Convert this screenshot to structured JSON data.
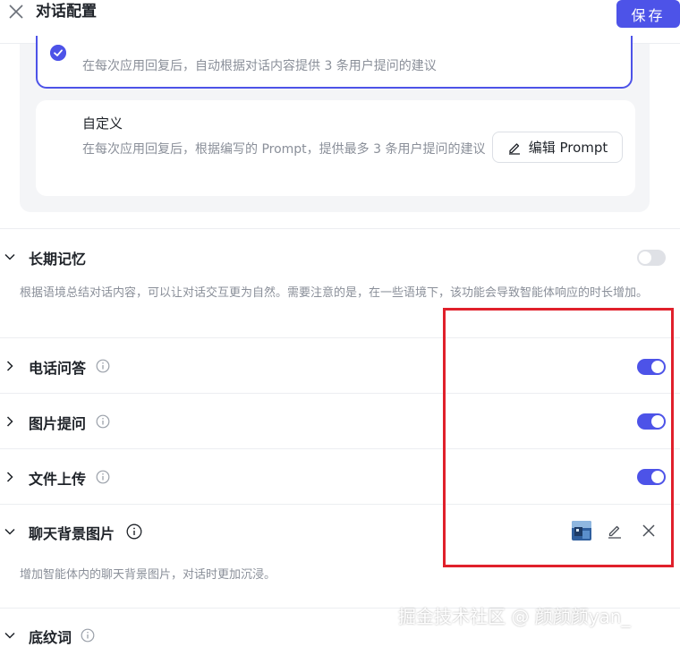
{
  "header": {
    "title": "对话配置",
    "save_label": "保存"
  },
  "suggestion": {
    "default_option_desc": "在每次应用回复后，自动根据对话内容提供 3 条用户提问的建议",
    "custom_option_title": "自定义",
    "custom_option_desc": "在每次应用回复后，根据编写的 Prompt，提供最多 3 条用户提问的建议",
    "edit_prompt_label": "编辑 Prompt"
  },
  "sections": {
    "long_memory": {
      "title": "长期记忆",
      "desc": "根据语境总结对话内容，可以让对话交互更为自然。需要注意的是，在一些语境下，该功能会导致智能体响应的时长增加。",
      "enabled": false
    },
    "phone_qa": {
      "title": "电话问答",
      "enabled": true
    },
    "image_question": {
      "title": "图片提问",
      "enabled": true
    },
    "file_upload": {
      "title": "文件上传",
      "enabled": true
    },
    "chat_background": {
      "title": "聊天背景图片",
      "desc": "增加智能体内的聊天背景图片，对话时更加沉浸。"
    },
    "shading_words": {
      "title": "底纹词"
    }
  },
  "watermark": "掘金技术社区 @ 颜颜颜yan_",
  "colors": {
    "accent": "#4d53e8",
    "highlight_box": "#e0202b"
  },
  "icons": [
    "close-icon",
    "check-icon",
    "pencil-icon",
    "chevron-down-icon",
    "chevron-right-icon",
    "info-icon",
    "close-icon"
  ]
}
